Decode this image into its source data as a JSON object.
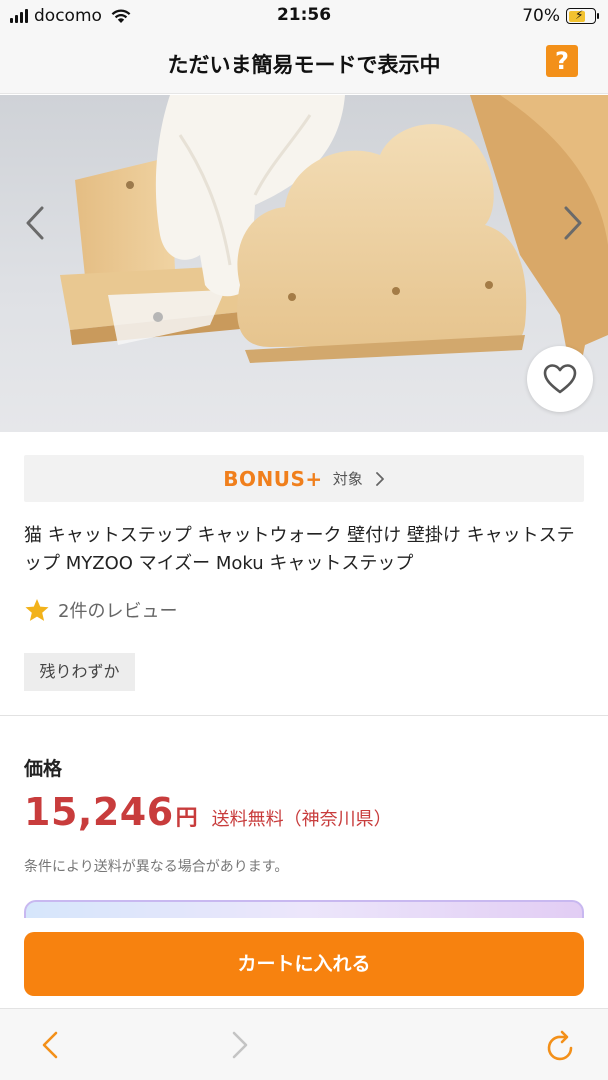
{
  "status_bar": {
    "carrier": "docomo",
    "time": "21:56",
    "battery_percent": "70%",
    "battery_level": 0.7,
    "icons": [
      "signal-icon",
      "wifi-icon",
      "battery-charging-icon"
    ]
  },
  "header": {
    "title": "ただいま簡易モードで表示中",
    "help_label": "?"
  },
  "gallery": {
    "icons": [
      "chevron-left-icon",
      "chevron-right-icon",
      "heart-icon"
    ]
  },
  "bonus": {
    "logo_text": "BONUS+",
    "target_label": "対象"
  },
  "product": {
    "title": "猫 キャットステップ キャットウォーク 壁付け 壁掛け キャットステップ MYZOO マイズー Moku キャットステップ",
    "review_text": "2件のレビュー",
    "stock_label": "残りわずか"
  },
  "price": {
    "label": "価格",
    "value": "15,246",
    "unit": "円",
    "shipping": "送料無料（神奈川県）",
    "note": "条件により送料が異なる場合があります。"
  },
  "cart": {
    "button_label": "カートに入れる"
  },
  "colors": {
    "accent_orange": "#f7820f",
    "price_red": "#c83c3c",
    "bonus_orange": "#f07f1c",
    "star_yellow": "#f2b21a"
  },
  "browser_toolbar": {
    "icons": [
      "back-arrow-icon",
      "forward-arrow-icon",
      "reload-icon"
    ]
  }
}
